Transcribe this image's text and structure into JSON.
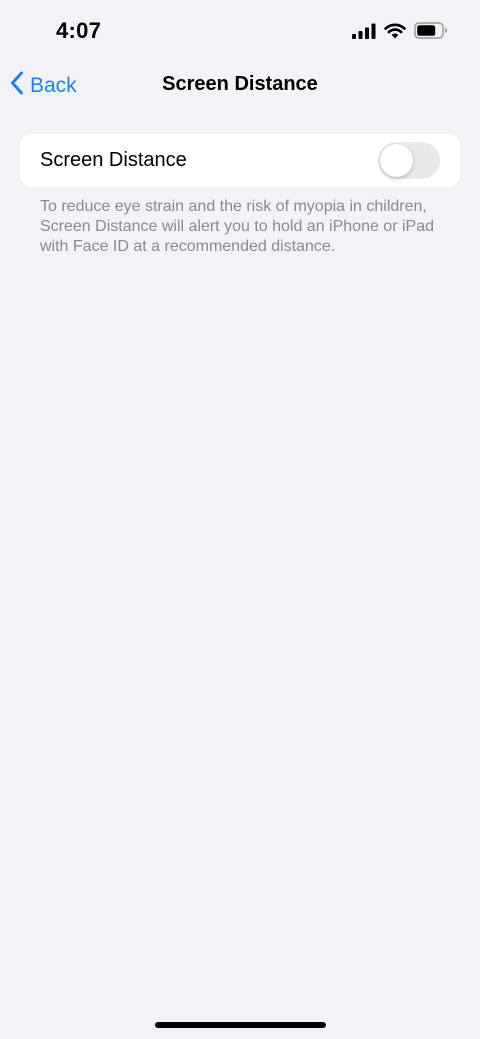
{
  "status_bar": {
    "time": "4:07"
  },
  "nav": {
    "back_label": "Back",
    "title": "Screen Distance"
  },
  "settings": {
    "row_label": "Screen Distance",
    "toggle_on": false,
    "footer": "To reduce eye strain and the risk of myopia in children, Screen Distance will alert you to hold an iPhone or iPad with Face ID at a recommended distance."
  },
  "colors": {
    "accent": "#1a82e8",
    "background": "#f2f2f7",
    "toggle_off": "#e9e9eb",
    "secondary_text": "#8a8a8e"
  }
}
